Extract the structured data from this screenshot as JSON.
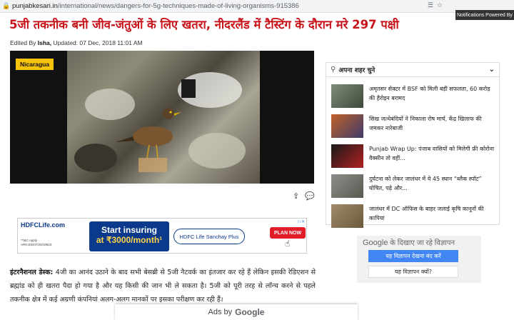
{
  "browser": {
    "domain": "punjabkesari.in",
    "path": "/international/news/dangers-for-5g-techniques-made-of-living-organisms-915386",
    "notification": "Notifications Powered By"
  },
  "article": {
    "headline": "5जी तकनीक बनी जीव-जंतुओं के लिए खतरा, नीदरलैंड में टैस्टिंग के दौरान मरे 297 पक्षी",
    "byline_prefix": "Edited By",
    "author": "Isha,",
    "updated": "Updated: 07 Dec, 2018 11:01 AM",
    "image_tag": "Nicaragua",
    "body_lead": "इंटरनैशनल डेस्क:",
    "body": "4जी का आनंद उठाने के बाद सभी बेसब्री से 5जी नैटवर्क का इंतजार कर रहे हैं लेकिन इसकी रेडिएशन से ब्रह्मांड को ही खतरा पैदा हो गया है और यह किसी की जान भी ले सकता है। 5जी को पूरी तरह से लॉन्च करने से पहले तकनीक क्षेत्र में कई अग्रणी कंपनियां अलग-अलग मानकों पर इसका परीक्षण कर रही हैं।"
  },
  "ad": {
    "logo": "HDFCLife.com",
    "fine_print": "*T&C Apply ARN:ED/07/20/19823",
    "line1": "Start insuring",
    "line2": "at ₹3000/month¹",
    "plan": "HDFC Life Sanchay Plus",
    "cta": "PLAN NOW"
  },
  "city_widget": {
    "title": "अपना शहर चुने",
    "items": [
      {
        "text": "अमृतसर सेक्टर में BSF को मिली बड़ी सफलता, 60 करोड़ की हैरोइन बरामद"
      },
      {
        "text": "सिख जत्थेबंदियों ने निकाला रोष मार्च, केंद्र खिलाफ की जमकर नारेबाजी"
      },
      {
        "text": "Punjab Wrap Up: पंजाब वासियों को मिलेगी फ्री कोरोना वैक्सीन तो वहीं..."
      },
      {
        "text": "दुर्घटना को लेकर जालंधर में ये 45 स्थान “ब्लैक स्पॉट” घोषित, पढ़े और..."
      },
      {
        "text": "जालंधर में DC ऑफिस के बाहर जलाई कृषि कानूनों की कापियां"
      }
    ]
  },
  "google_ads": {
    "google": "Google",
    "header": "के दिखाए जा रहे विज्ञापन",
    "stop_button": "यह विज्ञापन देखना बंद करें",
    "why_button": "यह विज्ञापन क्यों?",
    "ads_by": "Ads by",
    "ads_by_google": "Google"
  }
}
